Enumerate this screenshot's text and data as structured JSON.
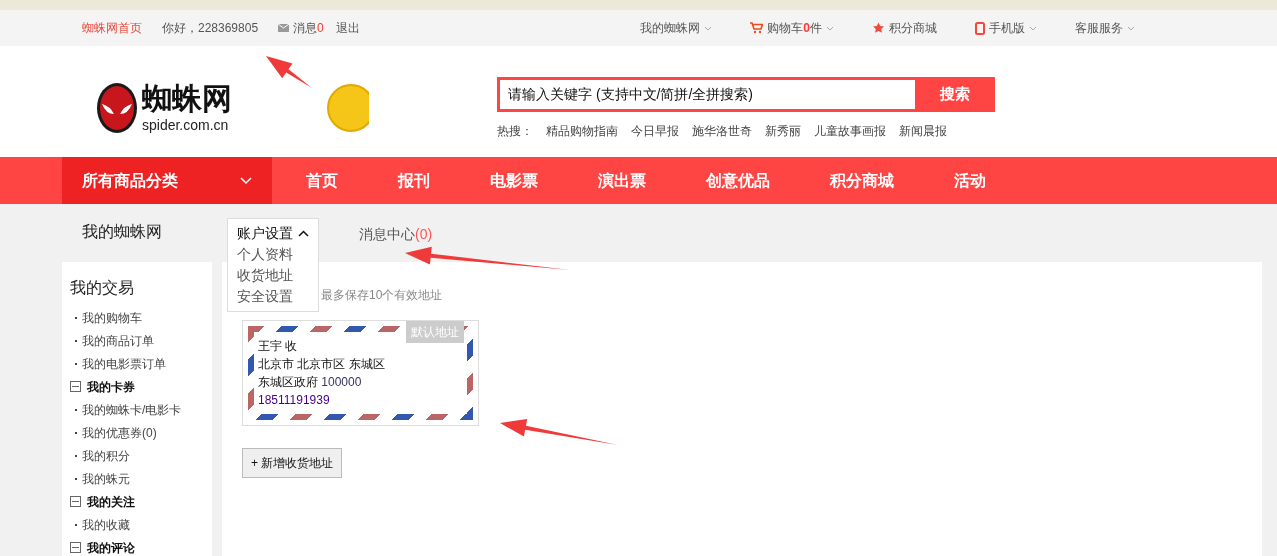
{
  "top_bar": {
    "home_link": "蜘蛛网首页",
    "greeting": "你好，228369805",
    "messages": {
      "label": "消息",
      "count": "0"
    },
    "logout": "退出",
    "right_links": [
      {
        "kind": "dropdown",
        "label": "我的蜘蛛网"
      },
      {
        "kind": "cart",
        "label": "购物车",
        "count": "0",
        "unit": "件"
      },
      {
        "kind": "star",
        "label": "积分商城"
      },
      {
        "kind": "phone",
        "label": "手机版"
      },
      {
        "kind": "dropdown",
        "label": "客服服务"
      }
    ]
  },
  "header": {
    "logo": {
      "name": "蜘蛛网",
      "domain": "spider.com.cn"
    },
    "search": {
      "placeholder": "请输入关键字 (支持中文/简拼/全拼搜索)",
      "button": "搜索"
    },
    "hot_label": "热搜：",
    "hot_searches": [
      "精品购物指南",
      "今日早报",
      "施华洛世奇",
      "新秀丽",
      "儿童故事画报",
      "新闻晨报"
    ]
  },
  "nav": {
    "categories": "所有商品分类",
    "items": [
      {
        "label": "首页"
      },
      {
        "label": "报刊"
      },
      {
        "label": "电影票"
      },
      {
        "label": "演出票"
      },
      {
        "label": "创意优品"
      },
      {
        "label": "积分商城"
      },
      {
        "label": "活动"
      }
    ]
  },
  "account": {
    "title": "我的蜘蛛网",
    "settings_menu": {
      "label": "账户设置",
      "expanded": true,
      "items": [
        "个人资料",
        "收货地址",
        "安全设置"
      ]
    },
    "message_center": {
      "label": "消息中心",
      "count": "(0)"
    }
  },
  "sidebar": {
    "title": "我的交易",
    "sections": [
      {
        "kind": "links",
        "items": [
          "我的购物车",
          "我的商品订单",
          "我的电影票订单"
        ]
      },
      {
        "kind": "group",
        "label": "我的卡券",
        "expanded": true,
        "items": [
          "我的蜘蛛卡/电影卡",
          "我的优惠券(0)",
          "我的积分",
          "我的蛛元"
        ]
      },
      {
        "kind": "group",
        "label": "我的关注",
        "expanded": true,
        "items": [
          "我的收藏"
        ]
      },
      {
        "kind": "group",
        "label": "我的评论",
        "expanded": true
      }
    ]
  },
  "addresses": {
    "note": "最多保存10个有效地址",
    "cards": [
      {
        "name": "王宇 收",
        "line1": "北京市 北京市区 东城区",
        "line2": "东城区政府",
        "postcode": "100000",
        "phone": "18511191939",
        "default": true,
        "default_label": "默认地址"
      }
    ],
    "add_button": "+ 新增收货地址"
  }
}
